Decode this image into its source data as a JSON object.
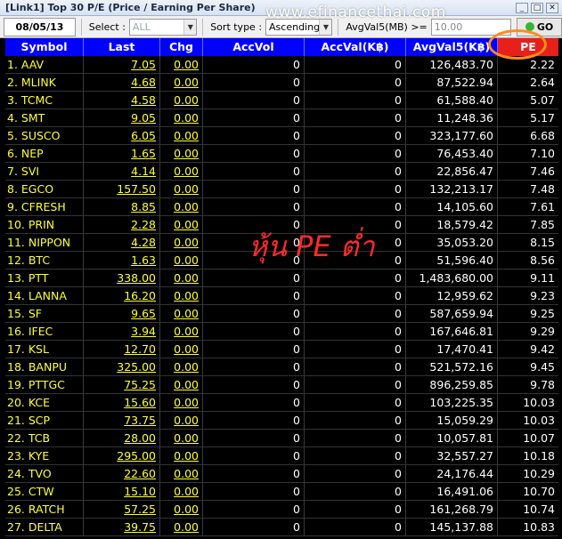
{
  "window": {
    "title": "[Link1] Top 30 P/E (Price / Earning Per Share)"
  },
  "watermark": "www.efinancethai.com",
  "toolbar": {
    "date": "08/05/13",
    "select_label": "Select :",
    "select_value": "ALL",
    "sort_label": "Sort type :",
    "sort_value": "Ascending",
    "avg_label": "AvgVal5(MB) >=",
    "avg_value": "10.00",
    "go_label": "GO"
  },
  "table": {
    "headers": [
      "Symbol",
      "Last",
      "Chg",
      "AccVol",
      "AccVal(K฿)",
      "AvgVal5(K฿)",
      "PE"
    ],
    "rows": [
      [
        "1. AAV",
        "7.05",
        "0.00",
        "0",
        "0",
        "126,483.70",
        "2.22"
      ],
      [
        "2. MLINK",
        "4.68",
        "0.00",
        "0",
        "0",
        "87,522.94",
        "2.64"
      ],
      [
        "3. TCMC",
        "4.58",
        "0.00",
        "0",
        "0",
        "61,588.40",
        "5.07"
      ],
      [
        "4. SMT",
        "9.05",
        "0.00",
        "0",
        "0",
        "11,248.36",
        "5.17"
      ],
      [
        "5. SUSCO",
        "6.05",
        "0.00",
        "0",
        "0",
        "323,177.60",
        "6.68"
      ],
      [
        "6. NEP",
        "1.65",
        "0.00",
        "0",
        "0",
        "76,453.40",
        "7.10"
      ],
      [
        "7. SVI",
        "4.14",
        "0.00",
        "0",
        "0",
        "22,856.47",
        "7.46"
      ],
      [
        "8. EGCO",
        "157.50",
        "0.00",
        "0",
        "0",
        "132,213.17",
        "7.48"
      ],
      [
        "9. CFRESH",
        "8.85",
        "0.00",
        "0",
        "0",
        "14,105.60",
        "7.61"
      ],
      [
        "10. PRIN",
        "2.28",
        "0.00",
        "0",
        "0",
        "18,579.42",
        "7.85"
      ],
      [
        "11. NIPPON",
        "4.28",
        "0.00",
        "0",
        "0",
        "35,053.20",
        "8.15"
      ],
      [
        "12. BTC",
        "1.63",
        "0.00",
        "0",
        "0",
        "51,596.40",
        "8.56"
      ],
      [
        "13. PTT",
        "338.00",
        "0.00",
        "0",
        "0",
        "1,483,680.00",
        "9.11"
      ],
      [
        "14. LANNA",
        "16.20",
        "0.00",
        "0",
        "0",
        "12,959.62",
        "9.23"
      ],
      [
        "15. SF",
        "9.65",
        "0.00",
        "0",
        "0",
        "587,659.94",
        "9.25"
      ],
      [
        "16. IFEC",
        "3.94",
        "0.00",
        "0",
        "0",
        "167,646.81",
        "9.29"
      ],
      [
        "17. KSL",
        "12.70",
        "0.00",
        "0",
        "0",
        "17,470.41",
        "9.42"
      ],
      [
        "18. BANPU",
        "325.00",
        "0.00",
        "0",
        "0",
        "521,572.16",
        "9.45"
      ],
      [
        "19. PTTGC",
        "75.25",
        "0.00",
        "0",
        "0",
        "896,259.85",
        "9.78"
      ],
      [
        "20. KCE",
        "15.60",
        "0.00",
        "0",
        "0",
        "103,225.35",
        "10.03"
      ],
      [
        "21. SCP",
        "73.75",
        "0.00",
        "0",
        "0",
        "15,059.29",
        "10.03"
      ],
      [
        "22. TCB",
        "28.00",
        "0.00",
        "0",
        "0",
        "10,057.81",
        "10.07"
      ],
      [
        "23. KYE",
        "295.00",
        "0.00",
        "0",
        "0",
        "32,557.27",
        "10.18"
      ],
      [
        "24. TVO",
        "22.60",
        "0.00",
        "0",
        "0",
        "24,176.44",
        "10.29"
      ],
      [
        "25. CTW",
        "15.10",
        "0.00",
        "0",
        "0",
        "16,491.06",
        "10.70"
      ],
      [
        "26. RATCH",
        "57.25",
        "0.00",
        "0",
        "0",
        "161,268.79",
        "10.74"
      ],
      [
        "27. DELTA",
        "39.75",
        "0.00",
        "0",
        "0",
        "145,137.88",
        "10.83"
      ]
    ]
  },
  "annotation": {
    "text": "หุ้น PE ต่ำ"
  },
  "colors": {
    "header_bg": "#0000ff",
    "pe_header_bg": "#e8201c",
    "symbol_text": "#ffff33",
    "highlight_circle": "#ff8c1a",
    "annotation_text": "#ff2a2a"
  }
}
